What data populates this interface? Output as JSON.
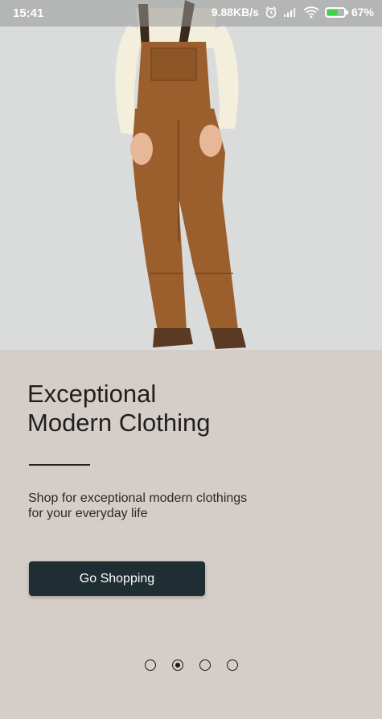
{
  "status_bar": {
    "time": "15:41",
    "network_speed": "9.88KB/s",
    "battery_percent": "67%",
    "battery_level": 0.67,
    "battery_color": "#3fd34a"
  },
  "hero": {
    "image_subject": "model wearing brown bib overalls over cream long-sleeve shirt"
  },
  "onboarding": {
    "title_line1": "Exceptional",
    "title_line2": "Modern Clothing",
    "subtitle_line1": "Shop for exceptional modern clothings",
    "subtitle_line2": "for your everyday life",
    "cta_label": "Go Shopping",
    "cta_color": "#1f2e33",
    "page_count": 4,
    "active_page": 2
  },
  "colors": {
    "background": "#d5cdc8",
    "hero_background": "#dadcdb",
    "overalls": "#9a5f2c"
  }
}
